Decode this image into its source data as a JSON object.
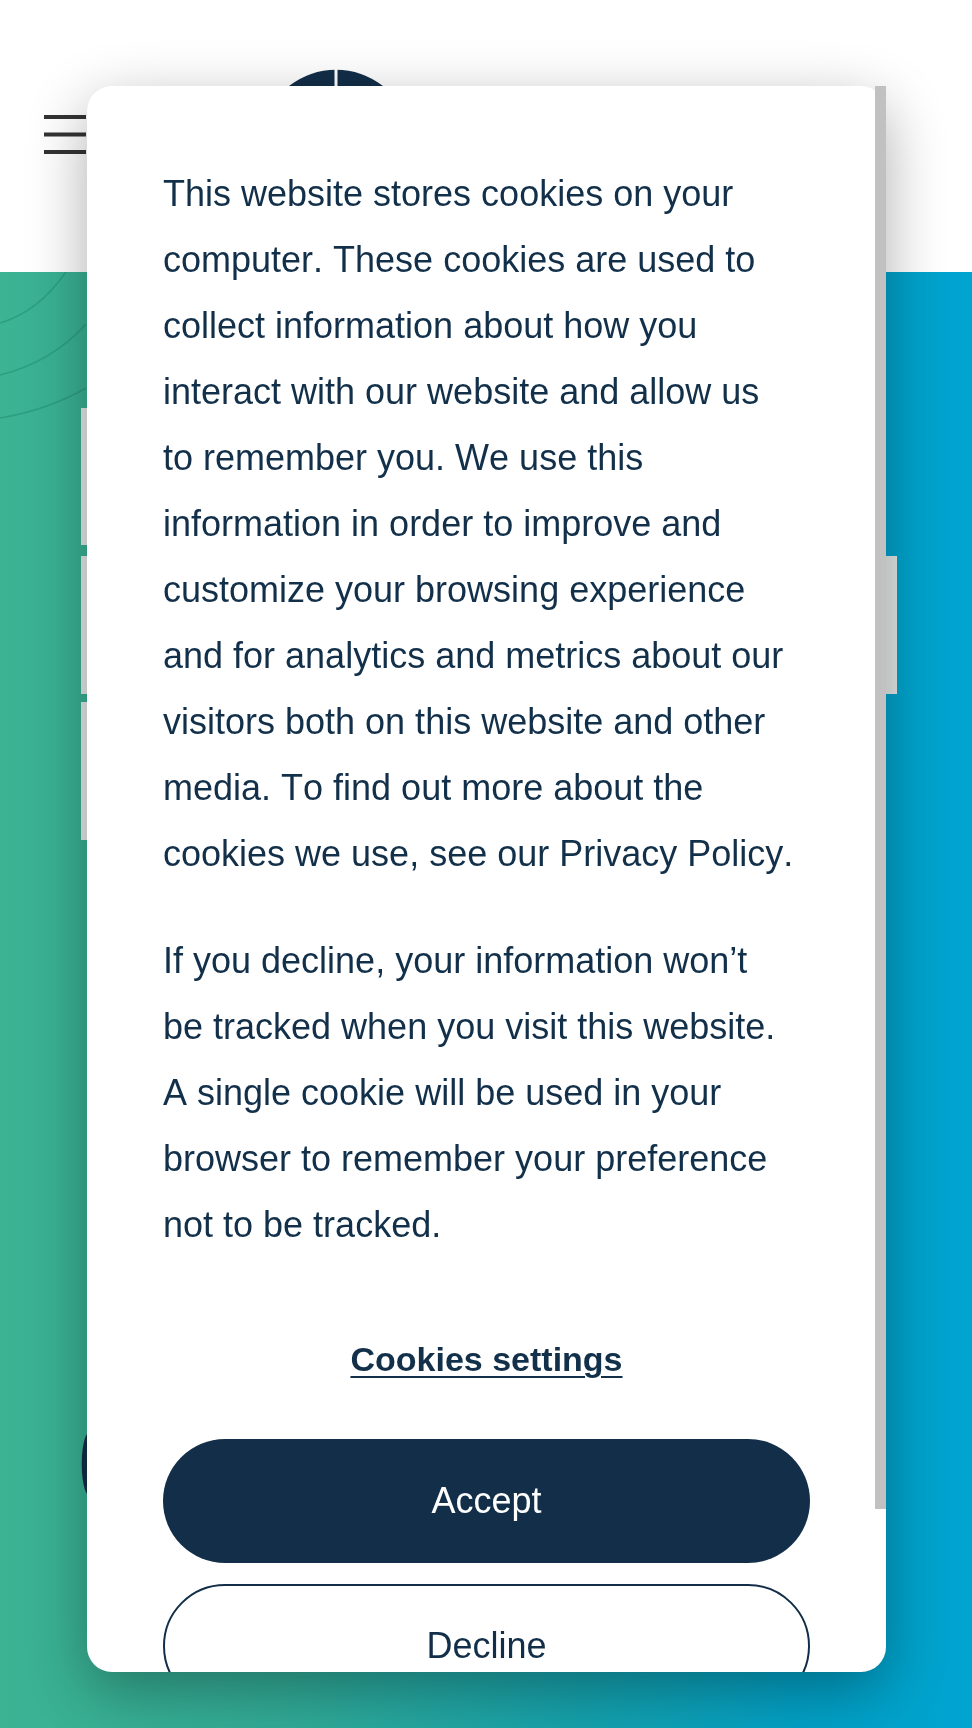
{
  "cookie_banner": {
    "paragraphs": [
      "This website stores cookies on your computer. These cookies are used to collect information about how you interact with our website and allow us to remember you. We use this information in order to improve and customize your browsing experience and for analytics and metrics about our visitors both on this website and other media. To find out more about the cookies we use, see our Privacy Policy.",
      "If you decline, your information won’t be tracked when you visit this website. A single cookie will be used in your browser to remember your preference not to be tracked."
    ],
    "settings_link": "Cookies settings",
    "buttons": [
      {
        "label": "Accept",
        "kind": "primary"
      },
      {
        "label": "Decline",
        "kind": "secondary"
      }
    ]
  }
}
